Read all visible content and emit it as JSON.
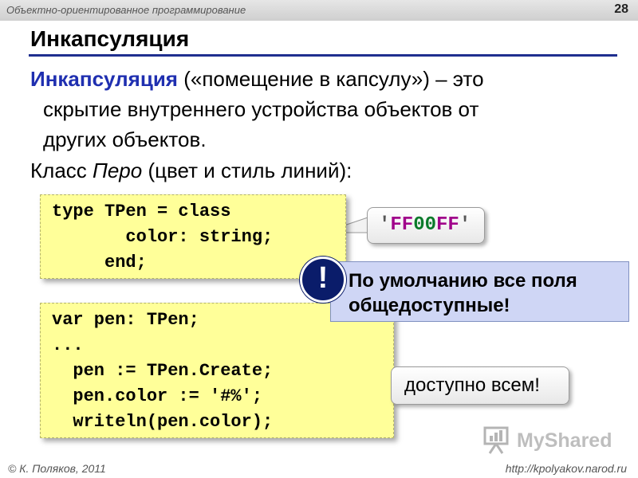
{
  "header": {
    "course": "Объектно-ориентированное программирование",
    "page_number": "28"
  },
  "slide": {
    "title": "Инкапсуляция",
    "definition": {
      "term": "Инкапсуляция",
      "line1_rest": " («помещение в капсулу») – это",
      "line2": "скрытие внутреннего устройства объектов от",
      "line3": "других объектов."
    },
    "class_line": {
      "prefix": "Класс ",
      "name": "Перо",
      "suffix": " (цвет и стиль линий):"
    }
  },
  "code_block_1": {
    "lines": [
      "type TPen = class",
      "       color: string;",
      "     end;"
    ]
  },
  "code_block_2": {
    "lines": [
      "var pen: TPen;",
      "...",
      "  pen := TPen.Create;",
      "  pen.color := '#%';",
      "  writeln(pen.color);"
    ]
  },
  "callout_value": {
    "quote": "'",
    "ff1": "FF",
    "zero": "00",
    "ff2": "FF"
  },
  "notice": {
    "symbol": "!",
    "line1": "По умолчанию все поля",
    "line2": "общедоступные!"
  },
  "callout_access": {
    "text": "доступно всем!"
  },
  "footer": {
    "author": "© К. Поляков, 2011",
    "url": "http://kpolyakov.narod.ru"
  },
  "watermark": {
    "text": "MyShared"
  }
}
